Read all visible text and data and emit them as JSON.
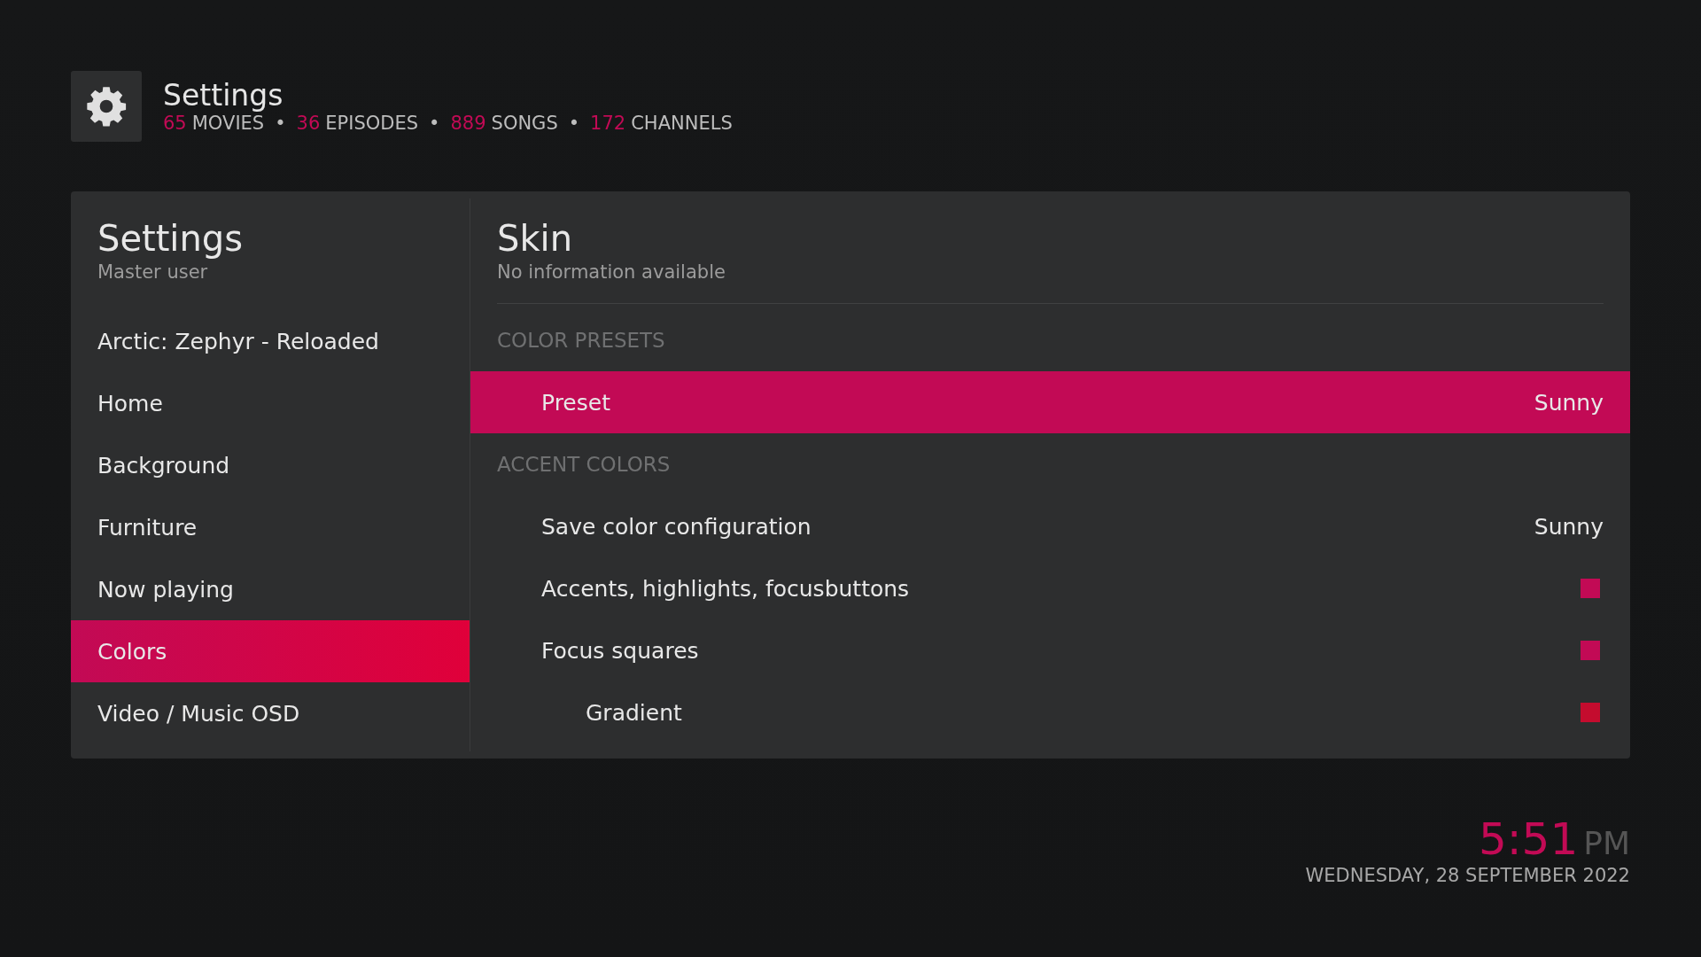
{
  "header": {
    "title": "Settings",
    "stats": [
      {
        "count": "65",
        "label": "MOVIES"
      },
      {
        "count": "36",
        "label": "EPISODES"
      },
      {
        "count": "889",
        "label": "SONGS"
      },
      {
        "count": "172",
        "label": "CHANNELS"
      }
    ],
    "separator": "•"
  },
  "sidebar": {
    "title": "Settings",
    "subtitle": "Master user",
    "items": [
      {
        "label": "Arctic: Zephyr - Reloaded",
        "selected": false
      },
      {
        "label": "Home",
        "selected": false
      },
      {
        "label": "Background",
        "selected": false
      },
      {
        "label": "Furniture",
        "selected": false
      },
      {
        "label": "Now playing",
        "selected": false
      },
      {
        "label": "Colors",
        "selected": true
      },
      {
        "label": "Video / Music OSD",
        "selected": false
      }
    ]
  },
  "content": {
    "title": "Skin",
    "subtitle": "No information available",
    "sections": [
      {
        "heading": "COLOR PRESETS",
        "items": [
          {
            "kind": "value",
            "label": "Preset",
            "value": "Sunny",
            "selected": true
          }
        ]
      },
      {
        "heading": "ACCENT COLORS",
        "items": [
          {
            "kind": "value",
            "label": "Save color configuration",
            "value": "Sunny",
            "selected": false
          },
          {
            "kind": "color",
            "label": "Accents, highlights, focusbuttons",
            "color": "#c20a55",
            "selected": false
          },
          {
            "kind": "color",
            "label": "Focus squares",
            "color": "#c20a55",
            "selected": false,
            "children": [
              {
                "kind": "color",
                "label": "Gradient",
                "color": "#c40c2e",
                "selected": false
              }
            ]
          }
        ]
      }
    ]
  },
  "clock": {
    "time": "5:51",
    "period": "PM",
    "date": "WEDNESDAY, 28 SEPTEMBER 2022"
  }
}
